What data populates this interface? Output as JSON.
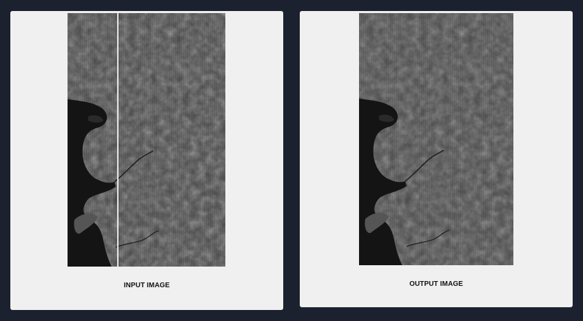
{
  "input": {
    "caption": "INPUT IMAGE"
  },
  "output": {
    "caption": "OUTPUT IMAGE"
  }
}
